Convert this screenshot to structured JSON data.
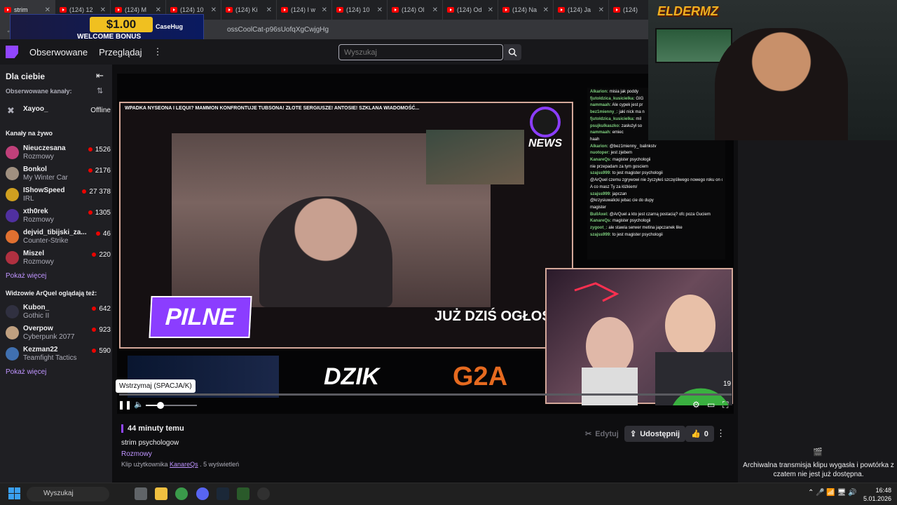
{
  "browser": {
    "tabs": [
      {
        "label": "strim",
        "active": true
      },
      {
        "label": "(124) 12"
      },
      {
        "label": "(124) M"
      },
      {
        "label": "(124) 10"
      },
      {
        "label": "(124) Ki"
      },
      {
        "label": "(124) I w"
      },
      {
        "label": "(124) 10"
      },
      {
        "label": "(124) Ol"
      },
      {
        "label": "(124) Od"
      },
      {
        "label": "(124) Na"
      },
      {
        "label": "(124) Ja"
      },
      {
        "label": "(124)"
      }
    ],
    "url": "ossCoolCat-p96sUofqXgCwjgHg"
  },
  "ad": {
    "price": "$1.00",
    "bonus": "WELCOME BONUS",
    "brand": "CaseHug"
  },
  "webcam": {
    "logo": "ELDERMZ"
  },
  "nav": {
    "followed": "Obserwowane",
    "browse": "Przeglądaj",
    "search_placeholder": "Wyszukaj"
  },
  "sidebar": {
    "title": "Dla ciebie",
    "followed_header": "Obserwowane kanały:",
    "followed": [
      {
        "name": "Xayoo_",
        "status": "Offline"
      }
    ],
    "live_header": "Kanały na żywo",
    "live": [
      {
        "name": "Nieuczesana",
        "game": "Rozmowy",
        "viewers": "1526",
        "color": "#c0407a"
      },
      {
        "name": "Bonkol",
        "game": "My Winter Car",
        "viewers": "2176",
        "color": "#a09080"
      },
      {
        "name": "IShowSpeed",
        "game": "IRL",
        "viewers": "27 378",
        "color": "#d0a020"
      },
      {
        "name": "xth0rek",
        "game": "Rozmowy",
        "viewers": "1305",
        "color": "#5030a0"
      },
      {
        "name": "dejvid_tibijski_za...",
        "game": "Counter-Strike",
        "viewers": "46",
        "color": "#e07030"
      },
      {
        "name": "Miszel",
        "game": "Rozmowy",
        "viewers": "220",
        "color": "#b03040"
      }
    ],
    "show_more": "Pokaż więcej",
    "also_header": "Widzowie ArQuel oglądają też:",
    "also": [
      {
        "name": "Kubon_",
        "game": "Gothic II",
        "viewers": "642",
        "color": "#303040"
      },
      {
        "name": "Overpow",
        "game": "Cyberpunk 2077",
        "viewers": "923",
        "color": "#c0a080"
      },
      {
        "name": "Kezman22",
        "game": "Teamfight Tactics",
        "viewers": "590",
        "color": "#4070b0"
      }
    ],
    "show_more2": "Pokaż więcej"
  },
  "video": {
    "ticker": "WPADKA NYSEONA I LEQUI? MAMMON KONFRONTUJE TUBSONA! ZŁOTE SERGIUSZE! ANTOSIE! SZKLANA WIADOMOŚĆ...",
    "pilne": "PILNE",
    "caption": "JUŻ DZIŚ OGŁOSZ",
    "news": "NEWS",
    "sponsor1": "DZIK",
    "sponsor2": "G2A",
    "counter": "19",
    "tooltip": "Wstrzymaj (SPACJA/K)",
    "volume": 0.29,
    "chat": [
      {
        "user": "Alkarion:",
        "msg": "misia jak poddy"
      },
      {
        "user": "fjutoldzica_kusicielka:",
        "msg": "GIG"
      },
      {
        "user": "nammaah:",
        "msg": "Ale cypek jest pr"
      },
      {
        "user": "bez1mienny_:",
        "msg": "jaki nick ma n"
      },
      {
        "user": "fjutoldzica_kusicielka:",
        "msg": "mil"
      },
      {
        "user": "psujkulkaszko:",
        "msg": "zasłużył so"
      },
      {
        "user": "nammaah:",
        "msg": "emiec"
      },
      {
        "user": "",
        "msg": "haah"
      },
      {
        "user": "Alkarion:",
        "msg": "@bez1mienny_ balinkstv"
      },
      {
        "user": "nuotoper:",
        "msg": "jest zjebem"
      },
      {
        "user": "KanareQs:",
        "msg": "magister psychologii"
      },
      {
        "user": "",
        "msg": "nie przepadam za tym gosciem"
      },
      {
        "user": "szajss999:",
        "msg": "to jest magister psychologii"
      },
      {
        "user": "",
        "msg": "@ArQuel czemu zgrywowi nie życzyłeś szczęśliwego nowego roku on czekał na to"
      },
      {
        "user": "",
        "msg": "A co masz Ty za łóżkiem/"
      },
      {
        "user": "szajss999:",
        "msg": "japczan"
      },
      {
        "user": "",
        "msg": "@krzysiuwalicki jebac cie do dupy"
      },
      {
        "user": "",
        "msg": "magister"
      },
      {
        "user": "BullAxel:",
        "msg": "@ArQuel a kto jest czarną postacią? ofc poza Guciem"
      },
      {
        "user": "KanareQs:",
        "msg": "magister psychologii"
      },
      {
        "user": "zygoot_:",
        "msg": "ale stawia serwer metina japczanek like"
      },
      {
        "user": "",
        "msg": ""
      },
      {
        "user": "szajss999:",
        "msg": "to jest magister psychologii"
      }
    ]
  },
  "clip": {
    "time_ago": "44 minuty temu",
    "title": "strim psychologow",
    "category": "Rozmowy",
    "by_prefix": "Klip użytkownika",
    "by_user": "KanareQs",
    "views": ". 5 wyświetleń",
    "edit": "Edytuj",
    "share": "Udostępnij",
    "likes": "0"
  },
  "chat_panel": {
    "archived": "Archiwalna transmisja klipu wygasła i powtórka z czatem nie jest już dostępna."
  },
  "taskbar": {
    "search": "Wyszukaj",
    "time": "16:48",
    "date": "5.01.2026"
  }
}
